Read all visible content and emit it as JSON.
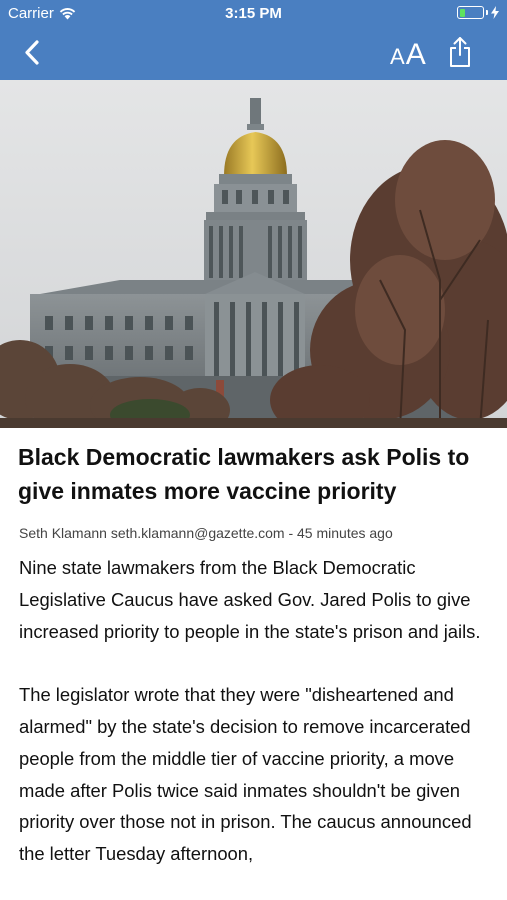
{
  "status_bar": {
    "carrier": "Carrier",
    "time": "3:15 PM",
    "battery_level": 0.25,
    "battery_color": "#5ee35e"
  },
  "nav_bar": {
    "background_color": "#4a7fc1",
    "back_icon": "chevron-left-icon",
    "font_size_small_label": "A",
    "font_size_large_label": "A",
    "share_icon": "share-icon"
  },
  "article": {
    "image_subject": "capitol-building-photo",
    "headline": "Black Democratic lawmakers ask Polis to give inmates more vaccine priority",
    "byline": "Seth Klamann seth.klamann@gazette.com - 45 minutes ago",
    "paragraphs": [
      "Nine state lawmakers from the Black Democratic Legislative Caucus have asked Gov. Jared Polis to give increased priority to people in the state's prison and jails.",
      "The legislator wrote that they were \"disheartened and alarmed\" by the state's decision to remove incarcerated people from the middle tier of vaccine priority, a move made after Polis twice said inmates shouldn't be given priority over those not in prison. The caucus announced the letter Tuesday afternoon,"
    ]
  }
}
